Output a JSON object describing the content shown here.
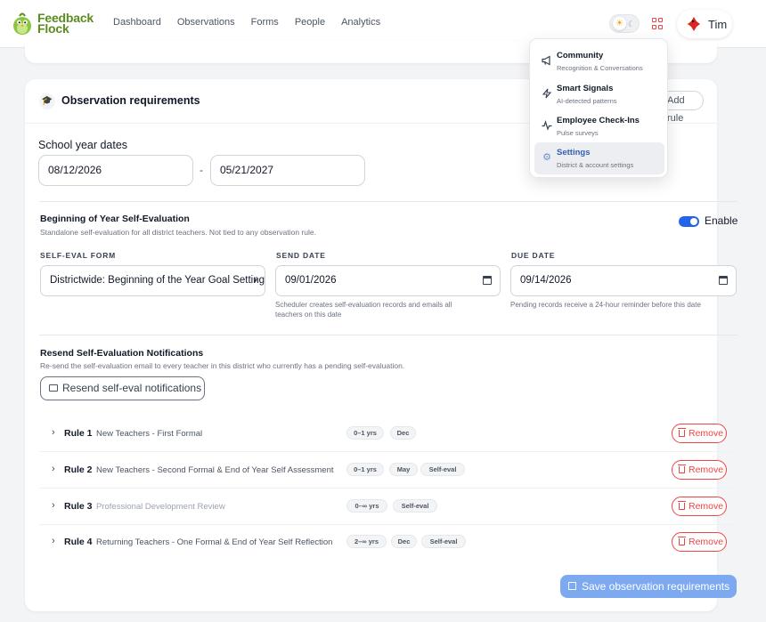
{
  "app": {
    "brand": "Feedback Flock",
    "brand_line1": "Feedback",
    "brand_line2": "Flock"
  },
  "nav": {
    "items": [
      "Dashboard",
      "Observations",
      "Forms",
      "People",
      "Analytics"
    ]
  },
  "user": {
    "name": "Tim"
  },
  "user_menu": [
    {
      "title": "Community",
      "subtitle": "Recognition & Conversations",
      "icon": "megaphone-icon"
    },
    {
      "title": "Smart Signals",
      "subtitle": "AI-detected patterns",
      "icon": "lightning-icon"
    },
    {
      "title": "Employee Check-Ins",
      "subtitle": "Pulse surveys",
      "icon": "pulse-icon"
    },
    {
      "title": "Settings",
      "subtitle": "District & account settings",
      "icon": "gear-icon",
      "active": true
    }
  ],
  "observation": {
    "title": "Observation requirements",
    "add_rule_label": "Add rule",
    "school_year_label": "School year dates",
    "start_date": "08/12/2026",
    "end_date": "05/21/2027",
    "date_separator": "-"
  },
  "self_eval": {
    "title": "Beginning of Year Self-Evaluation",
    "subtitle": "Standalone self-evaluation for all district teachers. Not tied to any observation rule.",
    "enabled": true,
    "enable_label": "Enable",
    "form_label": "SELF-EVAL FORM",
    "form_value": "Districtwide: Beginning of the Year Goal Setting",
    "send_date_label": "SEND DATE",
    "send_date_value": "09/01/2026",
    "send_hint_1": "Scheduler creates self-evaluation records and emails all",
    "send_hint_2": "teachers on this date",
    "due_date_label": "DUE DATE",
    "due_date_value": "09/14/2026",
    "due_hint": "Pending records receive a 24-hour reminder before this date"
  },
  "resend": {
    "title": "Resend Self-Evaluation Notifications",
    "subtitle": "Re-send the self-evaluation email to every teacher in this district who currently has a pending self-evaluation.",
    "button_label": "Resend self-eval notifications"
  },
  "rules": [
    {
      "label": "Rule 1",
      "name": "New Teachers - First Formal",
      "tags": [
        "0–1 yrs",
        "Dec"
      ],
      "remove_label": "Remove"
    },
    {
      "label": "Rule 2",
      "name": "New Teachers - Second Formal & End of Year Self Assessment",
      "tags": [
        "0–1 yrs",
        "May",
        "Self-eval"
      ],
      "remove_label": "Remove"
    },
    {
      "label": "Rule 3",
      "name": "Professional Development Review",
      "tags": [
        "0–∞ yrs",
        "Self-eval"
      ],
      "remove_label": "Remove"
    },
    {
      "label": "Rule 4",
      "name": "Returning Teachers - One Formal & End of Year Self Reflection",
      "tags": [
        "2–∞ yrs",
        "Dec",
        "Self-eval"
      ],
      "remove_label": "Remove"
    }
  ],
  "save_label": "Save observation requirements",
  "colors": {
    "brand_green": "#5b8c1e",
    "accent_blue": "#2563eb",
    "danger_red": "#ef4444"
  }
}
